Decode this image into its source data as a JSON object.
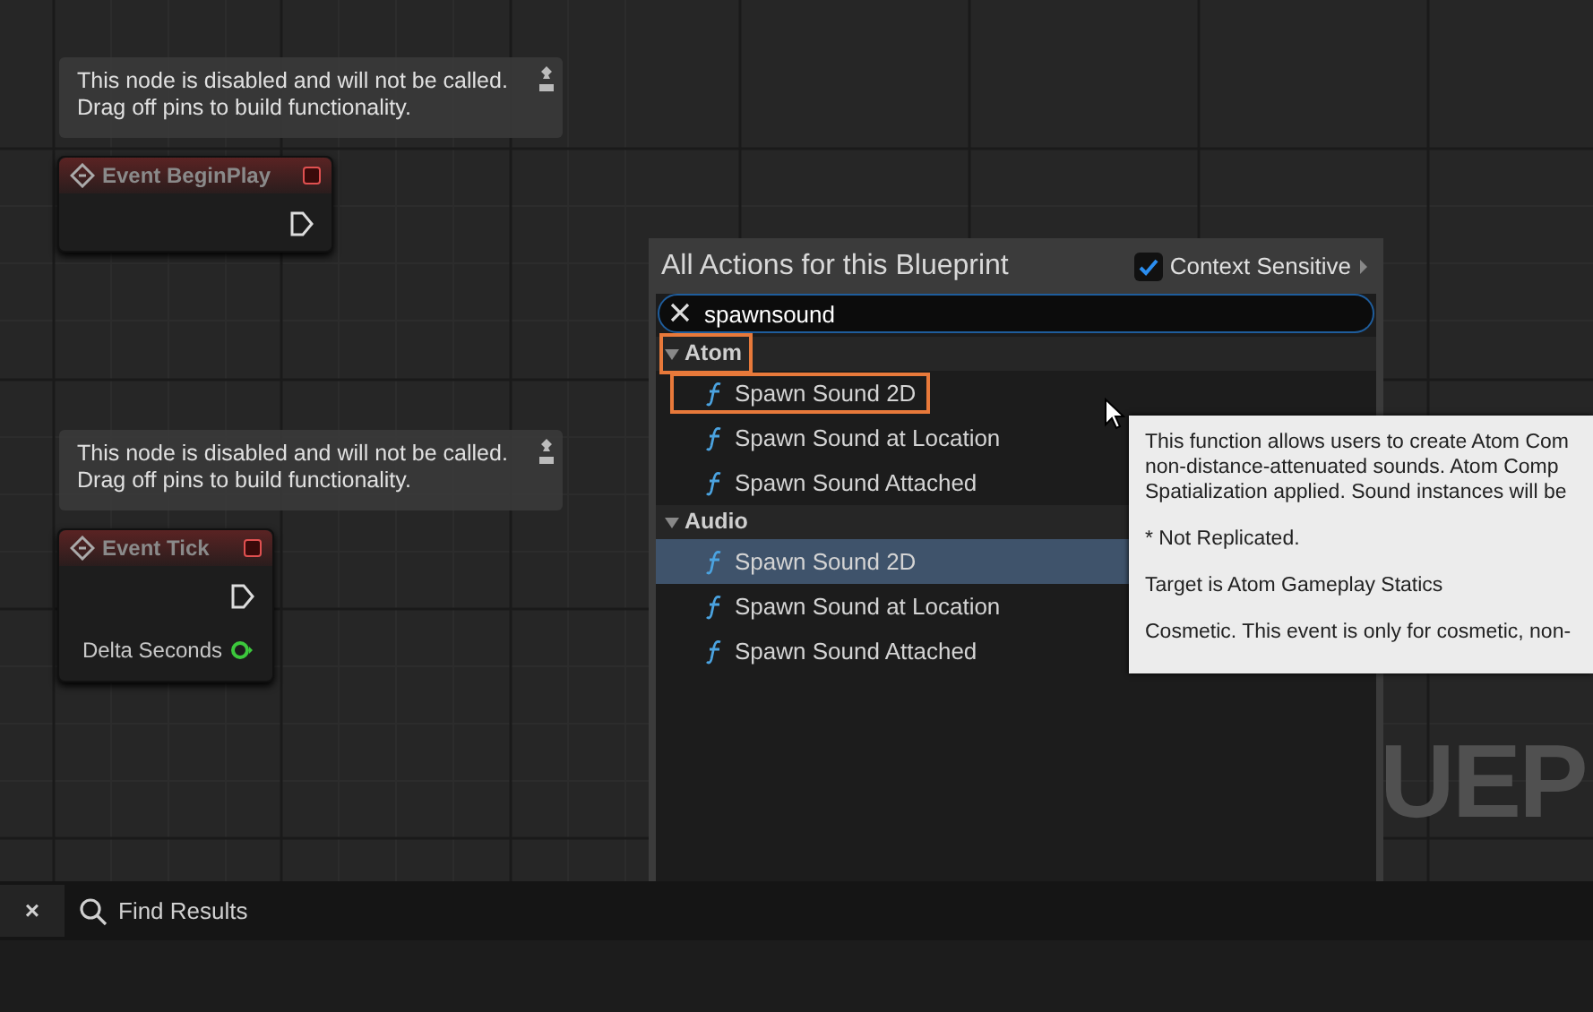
{
  "graph": {
    "nodes": [
      {
        "comment": "This node is disabled and will not be called.\nDrag off pins to build functionality.",
        "title": "Event BeginPlay",
        "disabled": true,
        "pins": [
          {
            "kind": "exec"
          }
        ]
      },
      {
        "comment": "This node is disabled and will not be called.\nDrag off pins to build functionality.",
        "title": "Event Tick",
        "disabled": true,
        "pins": [
          {
            "kind": "exec"
          },
          {
            "kind": "float",
            "label": "Delta Seconds"
          }
        ]
      }
    ],
    "watermark": "UEP"
  },
  "bottom_bar": {
    "tabs": [
      {
        "label": "×"
      },
      {
        "label": "Find Results"
      }
    ]
  },
  "action_menu": {
    "title": "All Actions for this Blueprint",
    "context_sensitive": {
      "label": "Context Sensitive",
      "checked": true
    },
    "search": {
      "value": "spawnsound"
    },
    "categories": [
      {
        "label": "Atom",
        "expanded": true,
        "highlighted": true,
        "children": [
          {
            "label": "Spawn Sound 2D",
            "selected": false,
            "highlighted": true
          },
          {
            "label": "Spawn Sound at Location",
            "selected": false,
            "highlighted": false
          },
          {
            "label": "Spawn Sound Attached",
            "selected": false,
            "highlighted": false
          }
        ]
      },
      {
        "label": "Audio",
        "expanded": true,
        "highlighted": false,
        "children": [
          {
            "label": "Spawn Sound 2D",
            "selected": true,
            "highlighted": false
          },
          {
            "label": "Spawn Sound at Location",
            "selected": false,
            "highlighted": false
          },
          {
            "label": "Spawn Sound Attached",
            "selected": false,
            "highlighted": false
          }
        ]
      }
    ]
  },
  "tooltip": {
    "paragraphs": [
      "This function allows users to create Atom Com\nnon-distance-attenuated sounds. Atom Comp\nSpatialization applied. Sound instances will be",
      "* Not Replicated.",
      "Target is Atom Gameplay Statics",
      "Cosmetic. This event is only for cosmetic, non-"
    ]
  }
}
